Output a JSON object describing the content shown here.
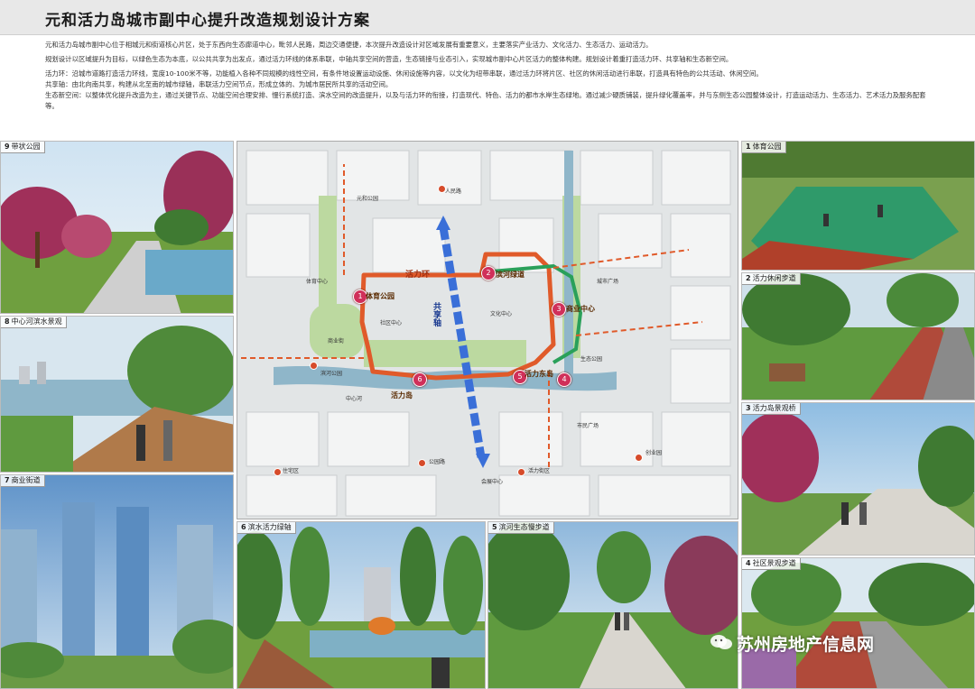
{
  "title": "元和活力岛城市副中心提升改造规划设计方案",
  "intro": {
    "p1": "元和活力岛城市副中心位于相城元和街道核心片区，处于东西向生态廊道中心，毗邻人民路，周边交通便捷，本次提升改造设计对区域发展有重要意义，主要落实产业活力、文化活力、生态活力、运动活力。",
    "p2": "规划设计以区域提升为目标，以绿色生态为本底，以公共共享为出发点，通过活力环线的体系串联，中轴共享空间的营造，生态链接与业态引入，实现城市副中心片区活力的整体构建。规划设计着重打造活力环、共享轴和生态新空间。",
    "p3": "活力环：沿城市道路打造活力环线，宽度10-100米不等，功能植入各种不同规模的线性空间，有条件地设置运动设施、休闲设施等内容，以文化为纽带串联，通过活力环将片区、社区的休闲活动进行串联，打造具有特色的公共活动、休闲空间。",
    "p4": "共享轴：由北向南共享，构建从北至南的城市绿轴，串联活力空间节点，形成立体的、为城市居民所共享的活动空间。",
    "p5": "生态新空间：以整体优化提升改造为主，通过关键节点、功能空间合理安排、慢行系统打造、滨水空间的改造提升，以及与活力环的衔接，打造现代、特色、活力的都市水岸生态绿地。通过减少硬质铺装，提升绿化覆盖率，并与东侧生态公园整体设计，打造运动活力、生态活力、艺术活力及服务配套等。"
  },
  "panels": {
    "p9": {
      "num": "9",
      "label": "带状公园"
    },
    "p8": {
      "num": "8",
      "label": "中心河滨水景观"
    },
    "p7": {
      "num": "7",
      "label": "商业街道"
    },
    "p6": {
      "num": "6",
      "label": "滨水活力绿轴"
    },
    "p5": {
      "num": "5",
      "label": "滨河生态慢步道"
    },
    "p1": {
      "num": "1",
      "label": "体育公园"
    },
    "p2": {
      "num": "2",
      "label": "活力休闲步道"
    },
    "p3": {
      "num": "3",
      "label": "活力岛景观桥"
    },
    "p4": {
      "num": "4",
      "label": "社区景观步道"
    }
  },
  "map": {
    "ring_label": "活力环",
    "axis_label": "共享轴",
    "markers": [
      "1",
      "2",
      "3",
      "4",
      "5",
      "6"
    ],
    "poi_big": [
      "体育公园",
      "滨河绿道",
      "活力岛",
      "活力东岛",
      "商业中心"
    ],
    "poi_small": [
      "元和公园",
      "人民路",
      "体育中心",
      "社区中心",
      "文化中心",
      "城市广场",
      "商业街",
      "滨河公园",
      "中心河",
      "生态公园",
      "创业园",
      "住宅区",
      "公园路",
      "活力街区",
      "会展中心",
      "市民广场"
    ]
  },
  "watermark": "苏州房地产信息网",
  "colors": {
    "ring": "#e05a2a",
    "green_ring": "#2aa05a",
    "axis": "#3a6fd8",
    "marker": "#d0305a",
    "water": "#8fb6c9"
  }
}
